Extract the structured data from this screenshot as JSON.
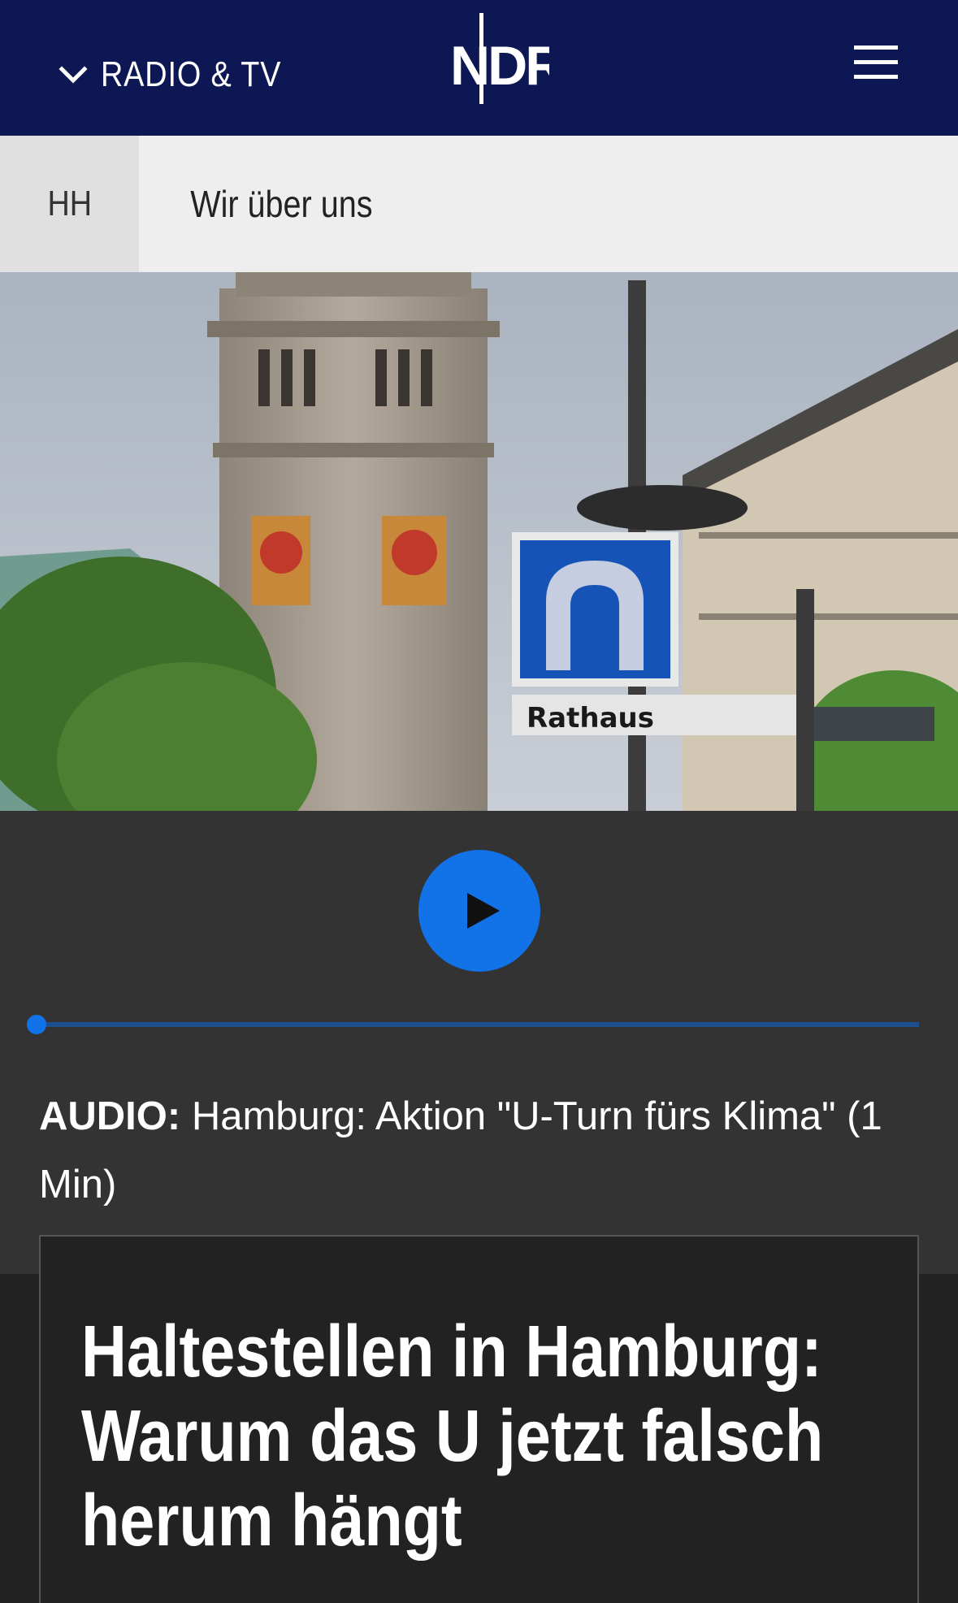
{
  "header": {
    "section_label": "RADIO & TV",
    "logo_text": "NDR",
    "menu_icon": "hamburger-menu-icon",
    "background": "#0c1754"
  },
  "subnav": {
    "region": "HH",
    "link": "Wir über uns"
  },
  "hero": {
    "sign_text": "Rathaus"
  },
  "audio": {
    "play_icon": "play-icon",
    "progress": 0,
    "accent": "#1272e8",
    "prefix": "AUDIO:",
    "title": "Hamburg: Aktion \"U-Turn fürs Klima\" (1 Min)"
  },
  "article": {
    "headline": "Haltestellen in Hamburg: Warum das U jetzt falsch herum hängt"
  }
}
